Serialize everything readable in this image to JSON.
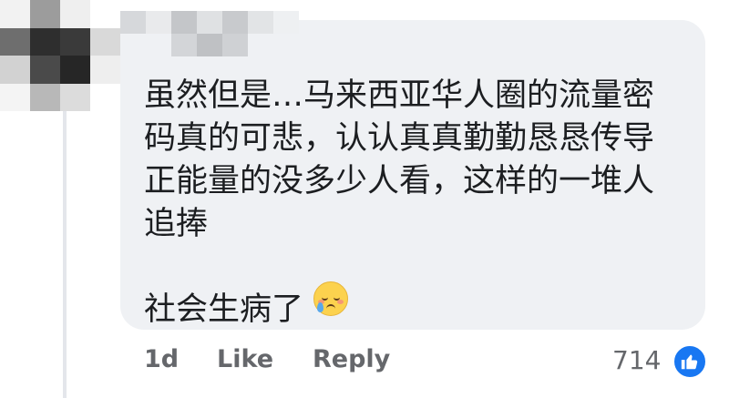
{
  "comment": {
    "text": "虽然但是…马来西亚华人圈的流量密\n码真的可悲，认认真真勤勤恳恳传导\n正能量的没多少人看，这样的一堆人\n追捧\n\n社会生病了",
    "emoji": "smiling-face-with-tear"
  },
  "actions": {
    "time": "1d",
    "like_label": "Like",
    "reply_label": "Reply",
    "reaction_count": "714"
  },
  "colors": {
    "bubble": "#eff1f4",
    "text": "#1c1e21",
    "meta": "#65676b",
    "like_blue": "#1877f2"
  }
}
